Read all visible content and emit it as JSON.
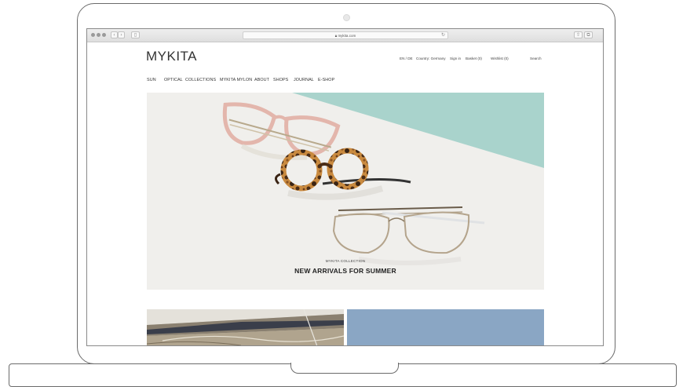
{
  "browser": {
    "url": "mykita.com",
    "back_icon": "chevron-left-icon",
    "forward_icon": "chevron-right-icon",
    "sidebar_icon": "sidebar-icon",
    "lock_icon": "lock-icon",
    "reload_icon": "reload-icon",
    "share_icon": "share-icon",
    "tabs_icon": "tabs-icon"
  },
  "site": {
    "logo": "MYKITA",
    "utility": {
      "language": "EN / DE",
      "country": "Country: Germany",
      "sign_in": "Sign in",
      "basket": "Basket (0)",
      "wishlist": "Wishlist (0)",
      "search": "Search"
    },
    "nav": [
      "SUN",
      "OPTICAL",
      "COLLECTIONS",
      "MYKITA MYLON",
      "ABOUT",
      "SHOPS",
      "JOURNAL",
      "E-SHOP"
    ],
    "hero": {
      "subtitle": "MYKITA COLLECTION",
      "title": "NEW ARRIVALS FOR SUMMER",
      "accent_color": "#a9d3cc"
    },
    "tiles": {
      "left_image": "marble-stone-image",
      "right_color": "#8aa6c4"
    }
  }
}
